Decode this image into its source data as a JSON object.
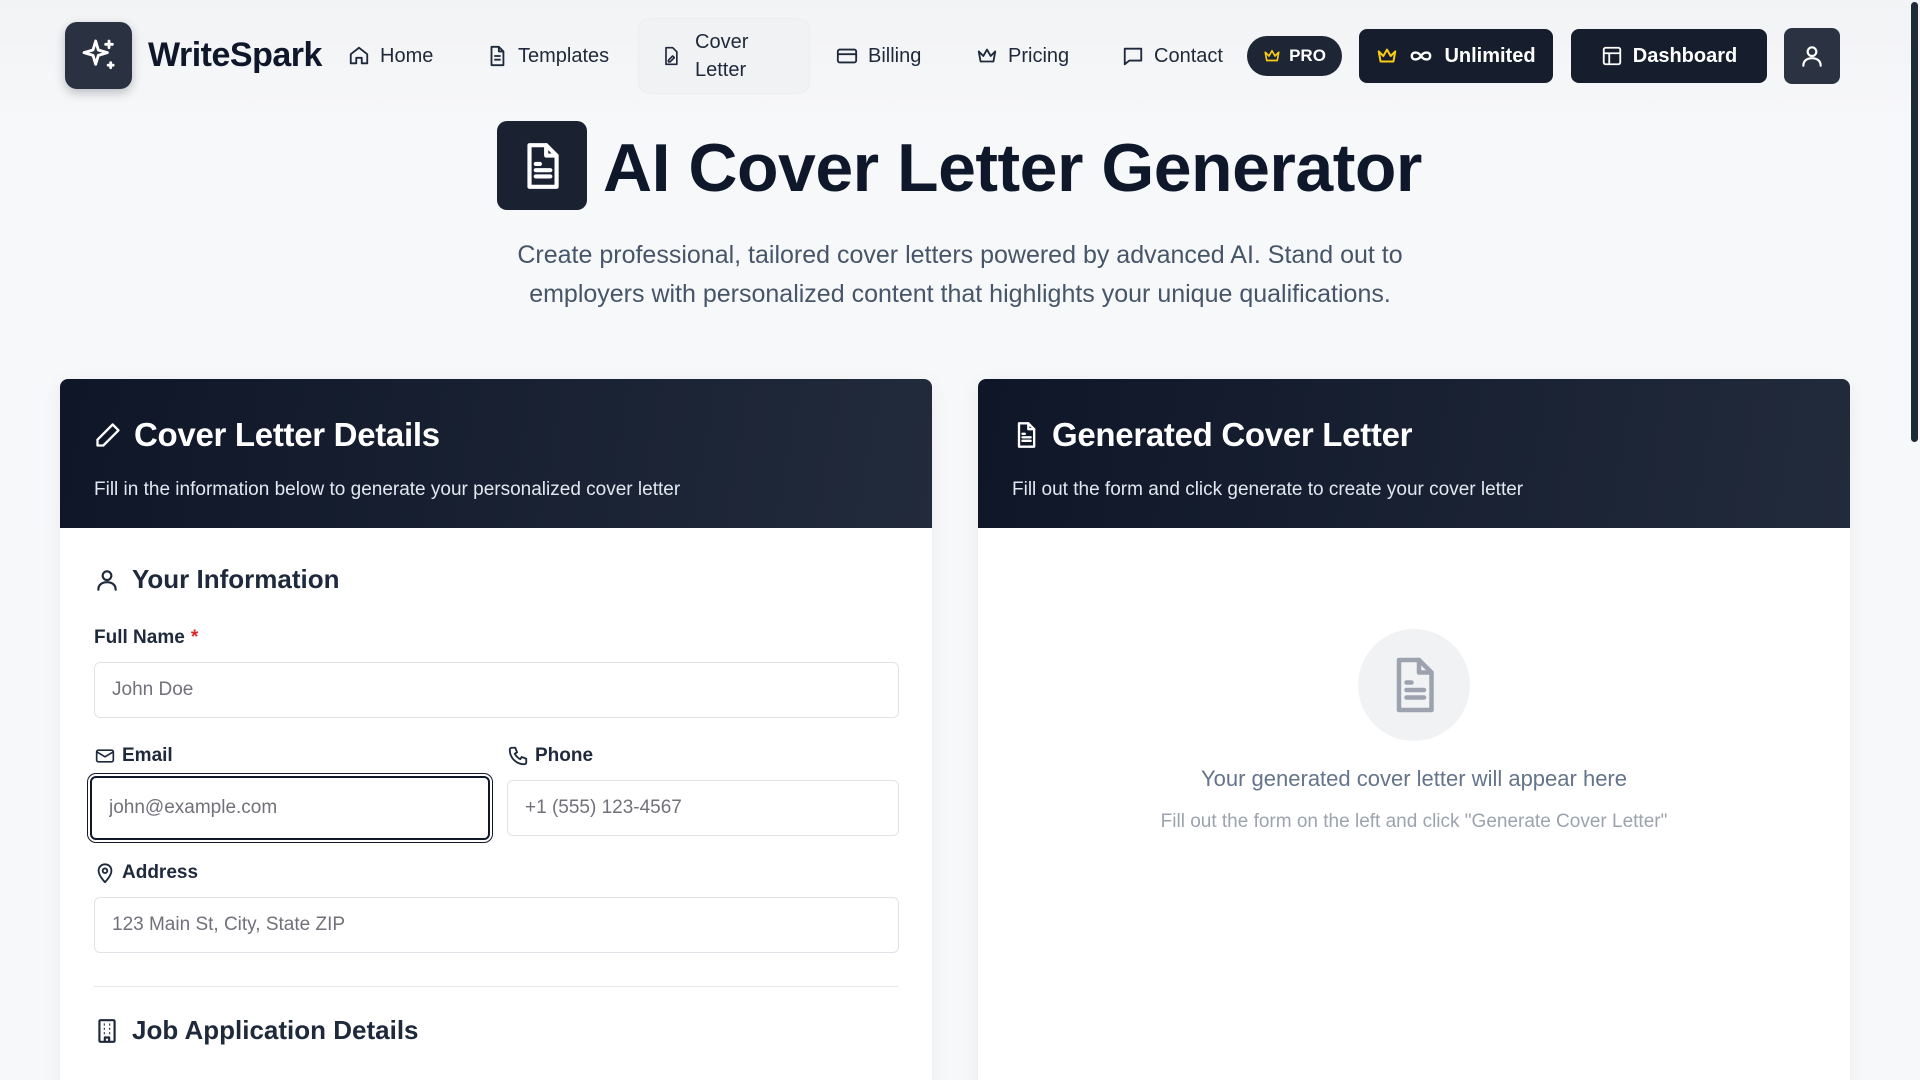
{
  "header": {
    "brand": "WriteSpark",
    "nav": [
      {
        "label": "Home",
        "icon": "home-icon"
      },
      {
        "label": "Templates",
        "icon": "document-icon"
      },
      {
        "label": "Cover Letter",
        "icon": "file-edit-icon"
      },
      {
        "label": "Billing",
        "icon": "credit-card-icon"
      },
      {
        "label": "Pricing",
        "icon": "crown-icon"
      },
      {
        "label": "Contact",
        "icon": "message-icon"
      }
    ],
    "pro_badge": "PRO",
    "unlimited_label": "Unlimited",
    "dashboard_label": "Dashboard"
  },
  "hero": {
    "title": "AI Cover Letter Generator",
    "subtitle": "Create professional, tailored cover letters powered by advanced AI. Stand out to employers with personalized content that highlights your unique qualifications."
  },
  "form_card": {
    "title": "Cover Letter Details",
    "description": "Fill in the information below to generate your personalized cover letter",
    "your_info_title": "Your Information",
    "full_name_label": "Full Name",
    "required_mark": "*",
    "full_name_placeholder": "John Doe",
    "email_label": "Email",
    "email_placeholder": "john@example.com",
    "phone_label": "Phone",
    "phone_placeholder": "+1 (555) 123-4567",
    "address_label": "Address",
    "address_placeholder": "123 Main St, City, State ZIP",
    "job_details_title": "Job Application Details"
  },
  "output_card": {
    "title": "Generated Cover Letter",
    "description": "Fill out the form and click generate to create your cover letter",
    "empty_title": "Your generated cover letter will appear here",
    "empty_hint": "Fill out the form on the left and click \"Generate Cover Letter\""
  },
  "colors": {
    "brand_dark": "#0f172a",
    "card_header": "#111a2b",
    "accent_gold": "#facc15",
    "required": "#dc2626"
  }
}
